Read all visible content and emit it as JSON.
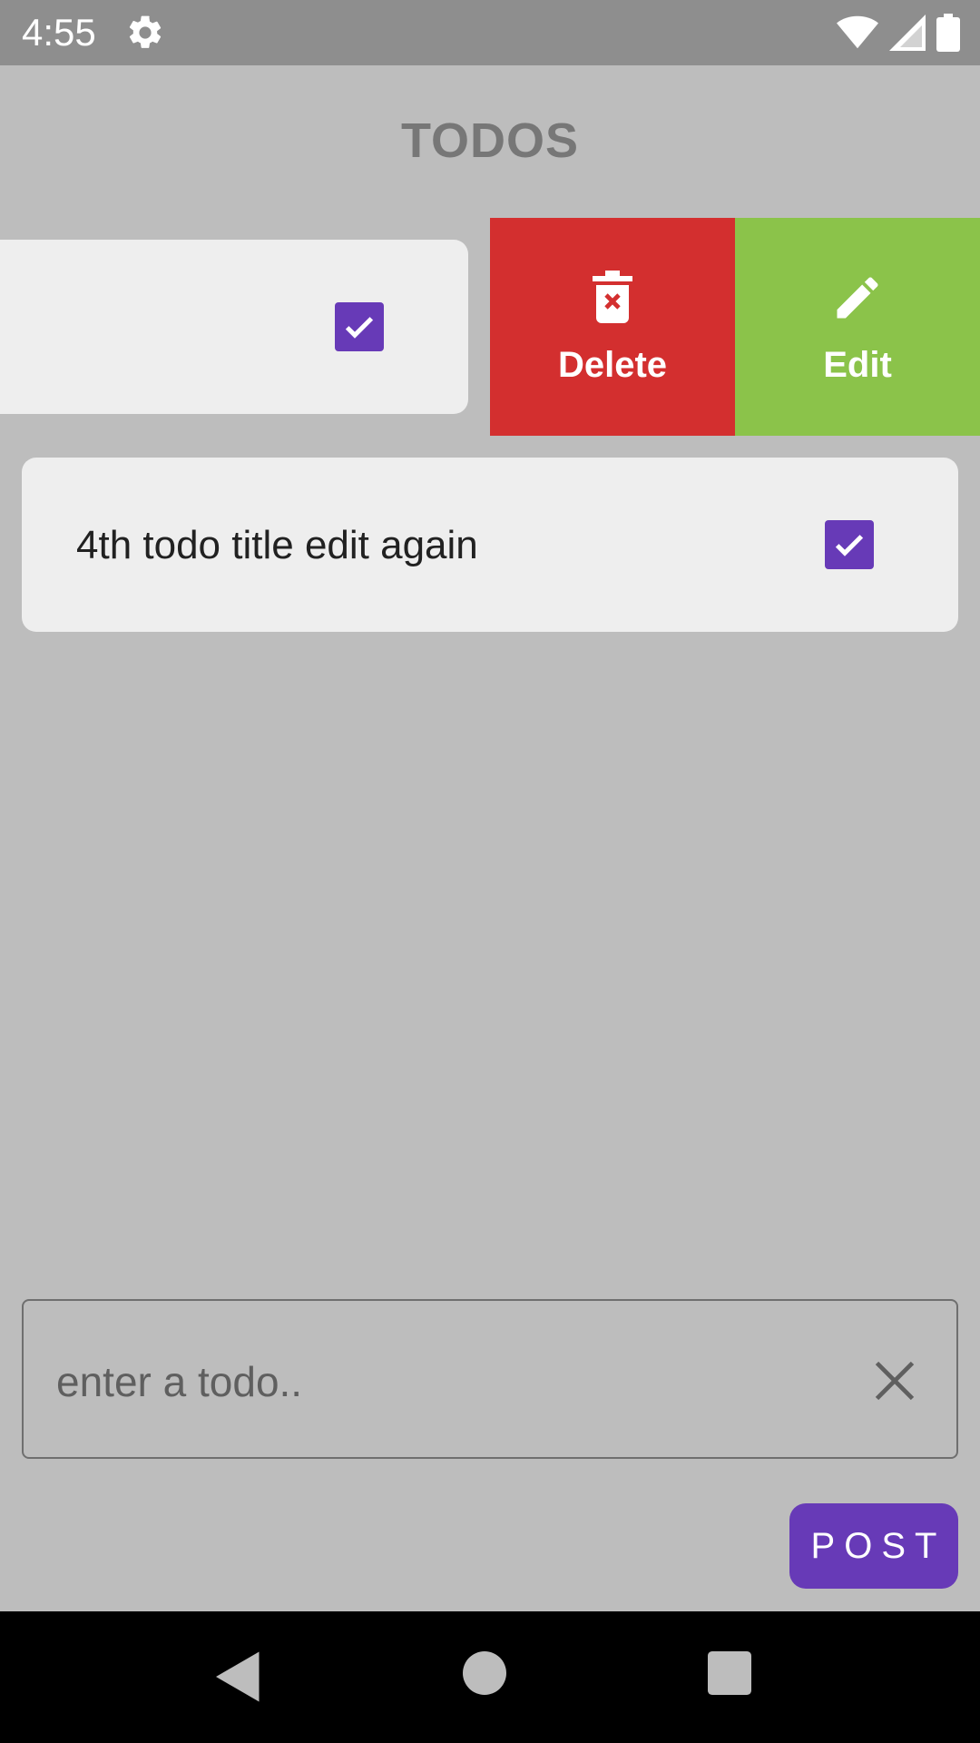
{
  "status_bar": {
    "time": "4:55",
    "icons": [
      "gear-icon",
      "wifi-icon",
      "signal-icon",
      "battery-icon"
    ]
  },
  "app_bar": {
    "title": "TODOS"
  },
  "todos": [
    {
      "title": "",
      "checked": true,
      "swiped": true,
      "actions": [
        {
          "label": "Delete",
          "icon": "trash-icon",
          "color": "#d32f2f"
        },
        {
          "label": "Edit",
          "icon": "pencil-icon",
          "color": "#8bc34a"
        }
      ]
    },
    {
      "title": "4th todo title edit again",
      "checked": true
    }
  ],
  "input": {
    "placeholder": "enter a todo..",
    "value": ""
  },
  "post_button": {
    "label": "POST"
  },
  "colors": {
    "accent": "#673ab7",
    "background": "#bdbdbd",
    "card": "#eeeeee",
    "delete": "#d32f2f",
    "edit": "#8bc34a"
  }
}
